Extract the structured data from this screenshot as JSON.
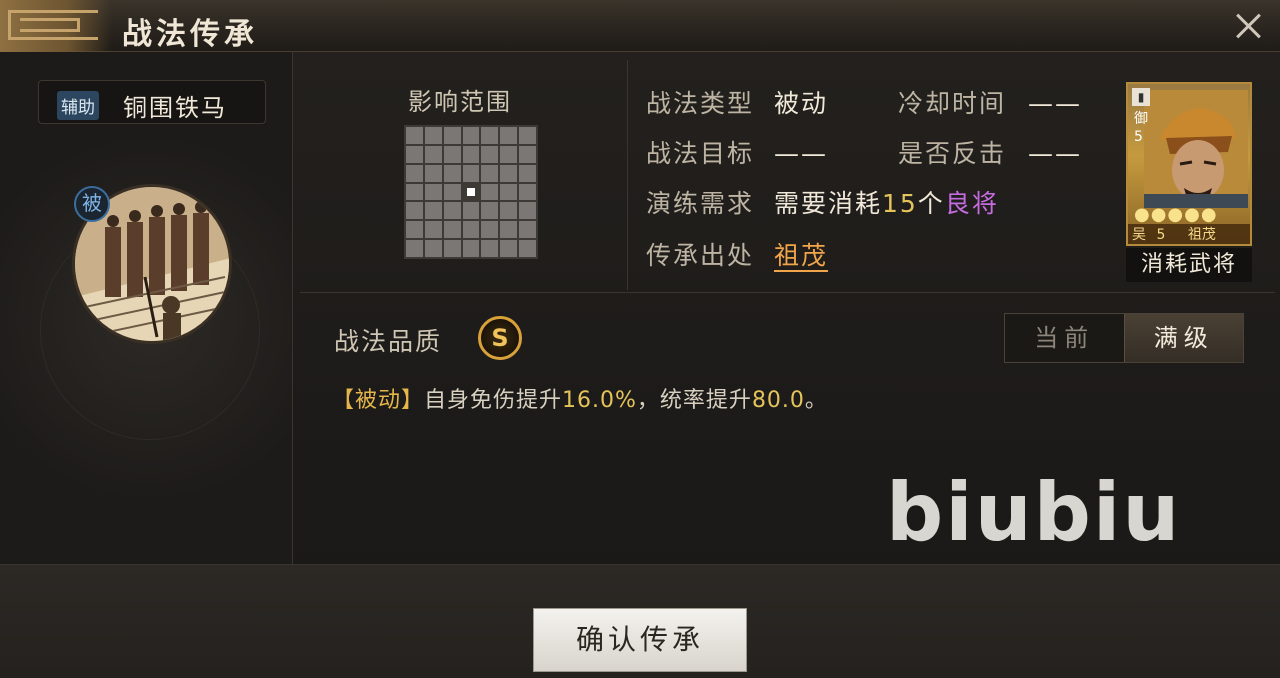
{
  "window": {
    "title": "战法传承",
    "close_icon": "close-icon"
  },
  "skill": {
    "tag": "辅助",
    "name": "铜围铁马",
    "passive_badge": "被"
  },
  "range": {
    "label": "影响范围",
    "grid_size": 7,
    "highlight_cell": [
      3,
      3
    ]
  },
  "info": {
    "type_label": "战法类型",
    "type_value": "被动",
    "cooldown_label": "冷却时间",
    "cooldown_value": "——",
    "target_label": "战法目标",
    "target_value": "——",
    "counter_label": "是否反击",
    "counter_value": "——",
    "req_label": "演练需求",
    "req_prefix": "需要消耗",
    "req_count": "15",
    "req_unit": "个",
    "req_item": "良将",
    "source_label": "传承出处",
    "source_value": "祖茂"
  },
  "hero_card": {
    "army": "▮",
    "side_text": "御5",
    "stars": "●●●●●",
    "faction": "吴",
    "cost": "5",
    "name": "祖茂",
    "caption": "消耗武将"
  },
  "quality": {
    "label": "战法品质",
    "grade": "S"
  },
  "toggle": {
    "current": "当前",
    "max": "满级"
  },
  "description": {
    "tag": "【被动】",
    "text1": "自身免伤提升",
    "num1": "16.0%",
    "text2": "，统率提升",
    "num2": "80.0",
    "text3": "。"
  },
  "watermark": "biubiu",
  "confirm_button": "确认传承",
  "colors": {
    "accent_gold": "#e4c45a",
    "purple": "#c46be0",
    "link_orange": "#f0a54a"
  }
}
